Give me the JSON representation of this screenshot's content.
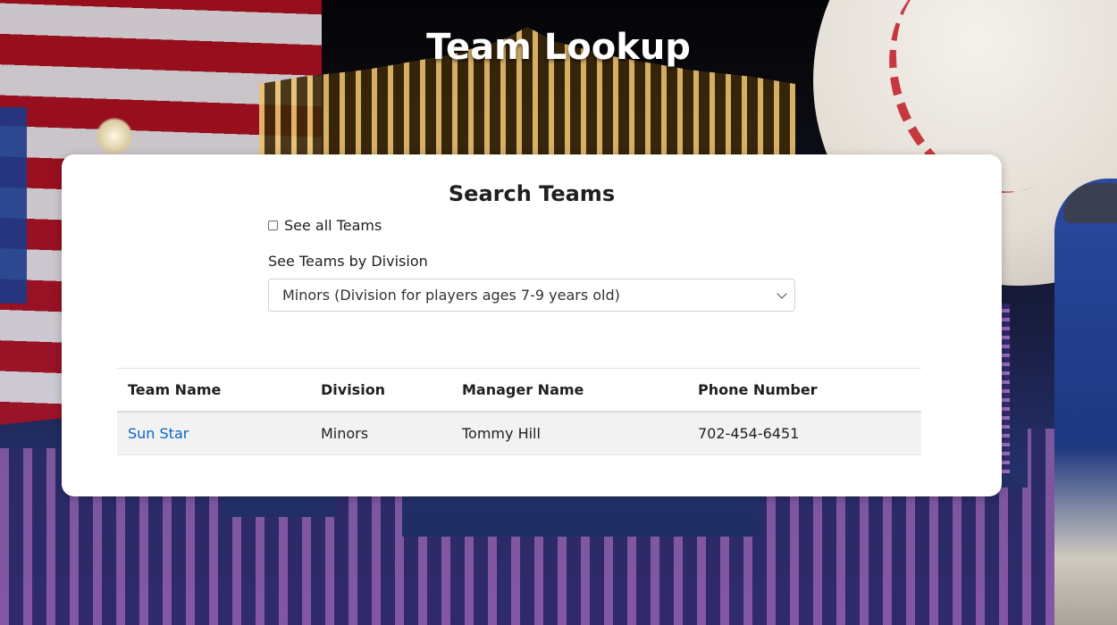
{
  "page": {
    "title": "Team Lookup"
  },
  "search": {
    "heading": "Search Teams",
    "see_all_label": "See all Teams",
    "see_all_checked": false,
    "division_label": "See Teams by Division",
    "division_selected": "Minors (Division for players ages 7-9 years old)"
  },
  "table": {
    "headers": [
      "Team Name",
      "Division",
      "Manager Name",
      "Phone Number"
    ],
    "rows": [
      {
        "team_name": "Sun Star",
        "division": "Minors",
        "manager": "Tommy Hill",
        "phone": "702-454-6451"
      }
    ]
  },
  "colors": {
    "link": "#0a66c2",
    "card_bg": "#ffffff",
    "row_bg": "#f2f2f2"
  },
  "icons": {
    "select_chevron": "chevron-down-icon",
    "checkbox": "checkbox-icon"
  }
}
